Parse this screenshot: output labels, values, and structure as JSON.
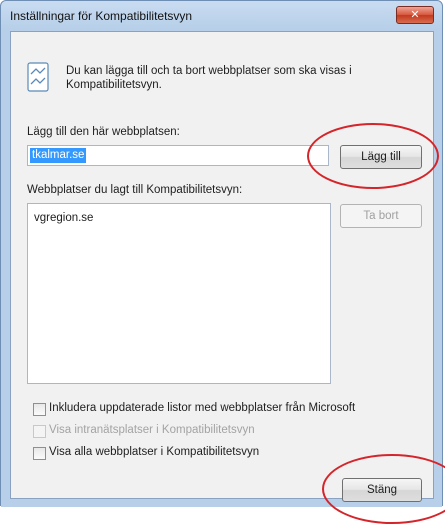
{
  "window": {
    "title": "Inställningar för Kompatibilitetsvyn",
    "close_glyph": "✕"
  },
  "info": {
    "text": "Du kan lägga till och ta bort webbplatser som ska visas i Kompatibilitetsvyn.",
    "icon": "compatibility-view-icon"
  },
  "add_site": {
    "label": "Lägg till den här webbplatsen:",
    "value": "tkalmar.se",
    "button_label": "Lägg till"
  },
  "site_list": {
    "label": "Webbplatser du lagt till Kompatibilitetsvyn:",
    "items": [
      "vgregion.se"
    ],
    "remove_label": "Ta bort"
  },
  "options": [
    {
      "label": "Inkludera uppdaterade listor med webbplatser från Microsoft",
      "checked": false,
      "enabled": true
    },
    {
      "label": "Visa intranätsplatser i Kompatibilitetsvyn",
      "checked": false,
      "enabled": false
    },
    {
      "label": "Visa alla webbplatser i Kompatibilitetsvyn",
      "checked": false,
      "enabled": true
    }
  ],
  "footer": {
    "close_label": "Stäng"
  },
  "colors": {
    "highlight": "#3399ff",
    "annotation": "#d4252b",
    "title_bar": "#c9dcf1"
  }
}
